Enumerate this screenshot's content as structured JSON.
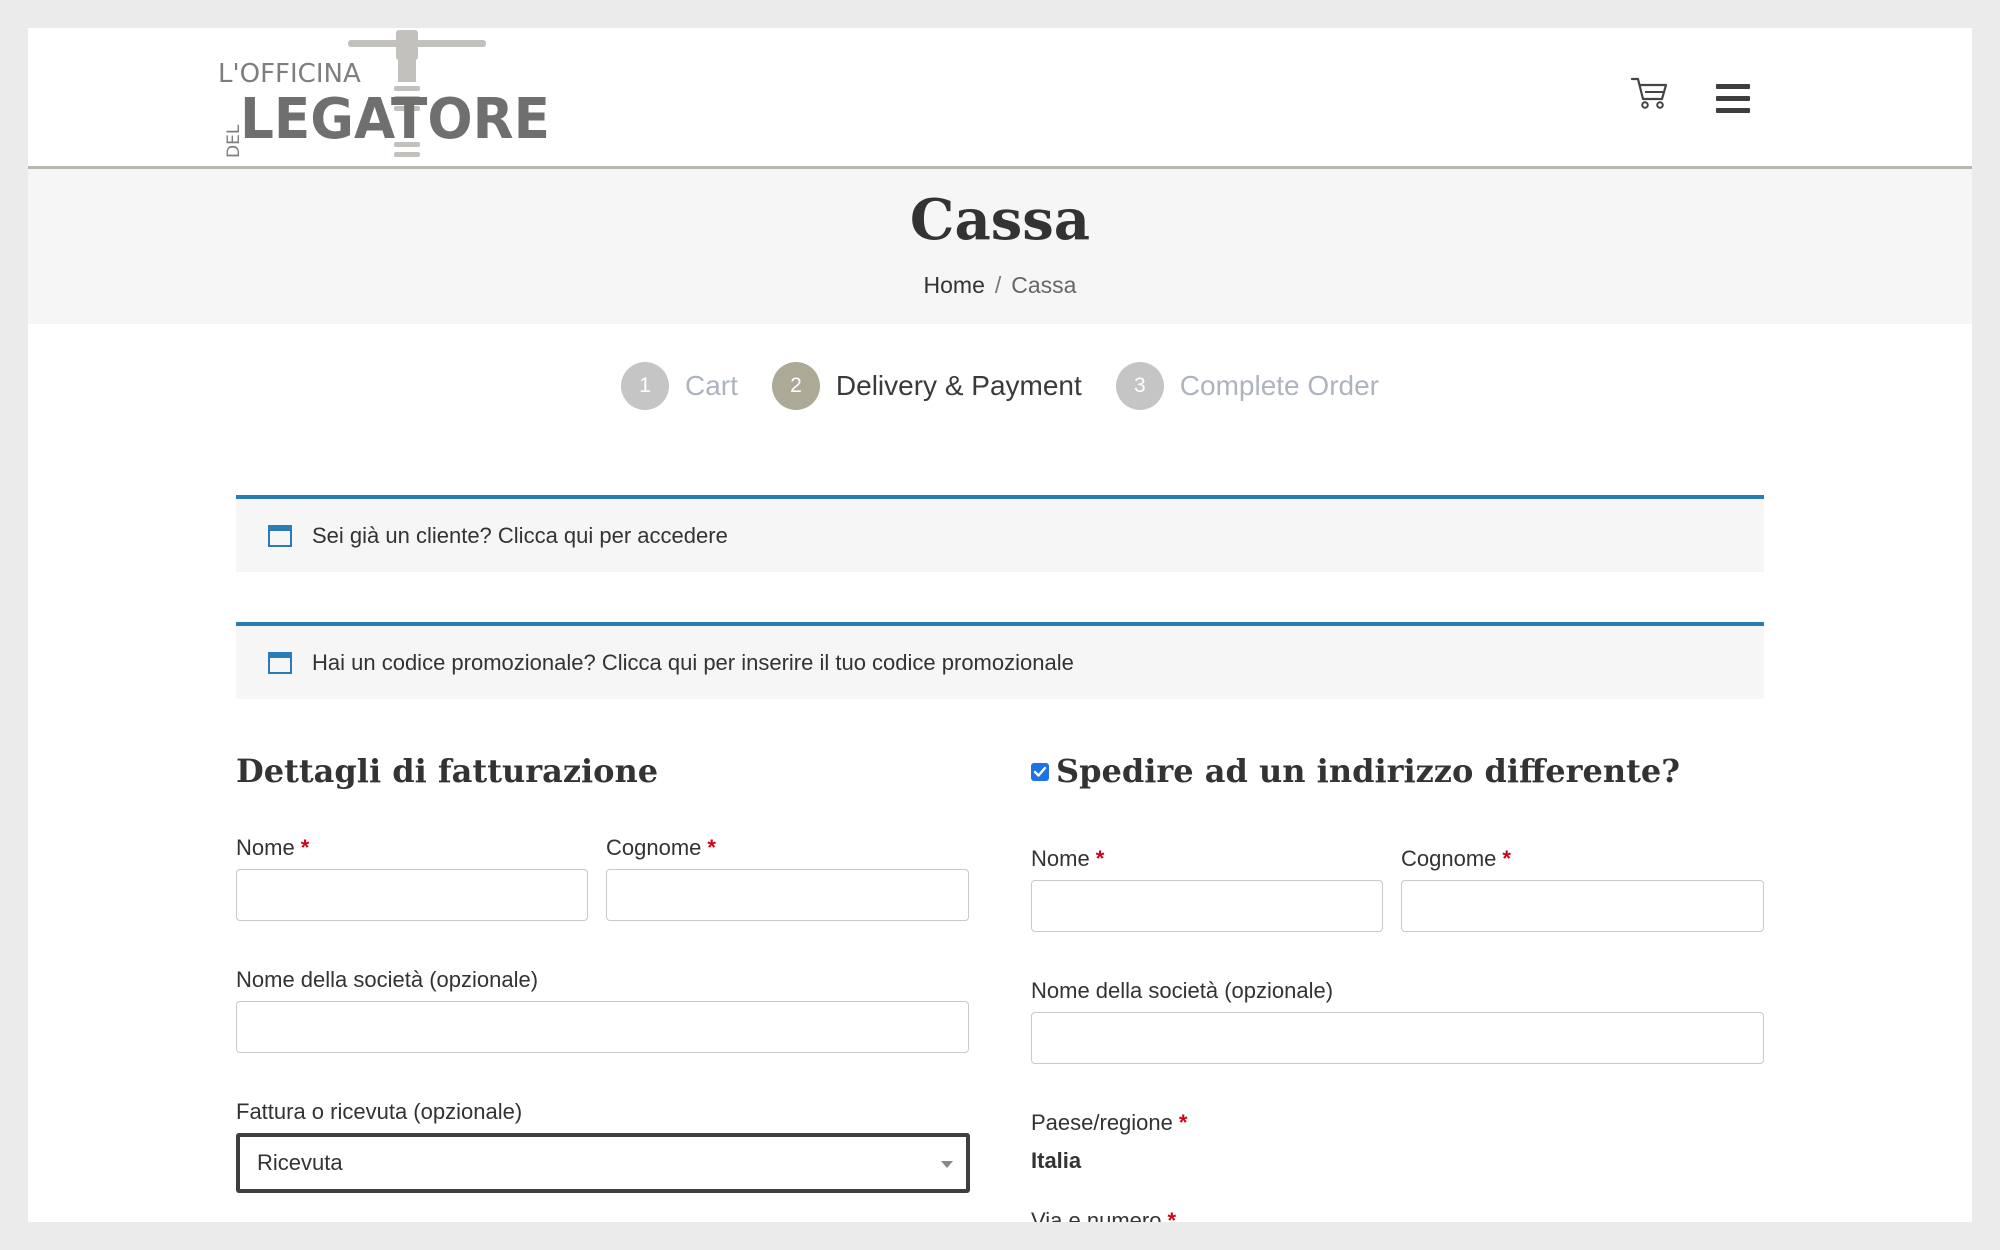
{
  "header": {
    "logo": {
      "line1": "L'OFFICINA",
      "line2": "LEGATORE",
      "side": "DEL"
    },
    "cart_icon": "cart-icon",
    "menu_icon": "hamburger-menu-icon"
  },
  "titlebar": {
    "title": "Cassa",
    "breadcrumb": {
      "home": "Home",
      "separator": "/",
      "current": "Cassa"
    }
  },
  "steps": [
    {
      "number": "1",
      "label": "Cart",
      "active": false
    },
    {
      "number": "2",
      "label": "Delivery & Payment",
      "active": true
    },
    {
      "number": "3",
      "label": "Complete Order",
      "active": false
    }
  ],
  "notices": {
    "login": "Sei già un cliente? Clicca qui per accedere",
    "coupon": "Hai un codice promozionale? Clicca qui per inserire il tuo codice promozionale"
  },
  "billing": {
    "title": "Dettagli di fatturazione",
    "first_name_label": "Nome",
    "last_name_label": "Cognome",
    "company_label": "Nome della società (opzionale)",
    "invoice_label": "Fattura o ricevuta (opzionale)",
    "invoice_value": "Ricevuta"
  },
  "shipping": {
    "title": "Spedire ad un indirizzo differente?",
    "checked": true,
    "first_name_label": "Nome",
    "last_name_label": "Cognome",
    "company_label": "Nome della società (opzionale)",
    "country_label": "Paese/regione",
    "country_value": "Italia",
    "street_label": "Via e numero"
  },
  "required_mark": "*",
  "colors": {
    "accent": "#2b7bb7",
    "active_step": "#aca996",
    "required": "#d0021b"
  }
}
